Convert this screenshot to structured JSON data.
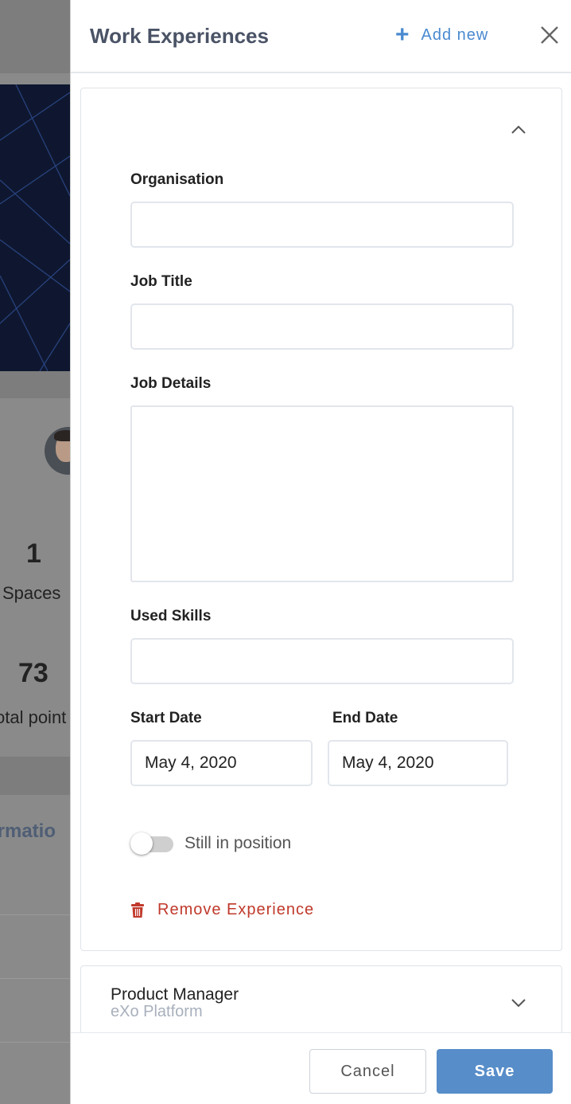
{
  "background": {
    "spaces_count": "1",
    "spaces_label": "Spaces",
    "points_count": "73",
    "points_label": "otal point",
    "info_label": "formatio"
  },
  "drawer": {
    "title": "Work Experiences",
    "add_new_label": "Add new",
    "close_icon": "close-icon"
  },
  "form": {
    "organisation_label": "Organisation",
    "organisation_value": "",
    "job_title_label": "Job Title",
    "job_title_value": "",
    "job_details_label": "Job Details",
    "job_details_value": "",
    "used_skills_label": "Used Skills",
    "used_skills_value": "",
    "start_date_label": "Start Date",
    "start_date_value": "May 4, 2020",
    "end_date_label": "End Date",
    "end_date_value": "May 4, 2020",
    "still_in_position_label": "Still in position",
    "still_in_position_on": false,
    "remove_label": "Remove Experience"
  },
  "experiences": [
    {
      "title": "Product Manager",
      "company": "eXo Platform"
    }
  ],
  "footer": {
    "cancel_label": "Cancel",
    "save_label": "Save"
  },
  "colors": {
    "accent": "#4a8ad0",
    "save_button": "#578dc9",
    "danger": "#c0392b"
  }
}
